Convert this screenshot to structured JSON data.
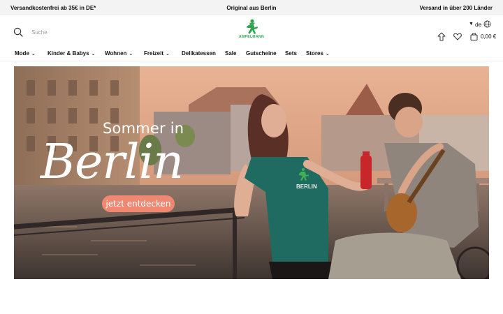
{
  "topbar": {
    "left": "Versandkostenfrei ab 35€ in DE*",
    "center": "Original aus Berlin",
    "right": "Versand in über 200 Länder"
  },
  "header": {
    "search_placeholder": "Suche",
    "logo_text": "AMPELMANN",
    "language": "de",
    "cart_total": "0,00 €",
    "brand_color": "#2ea44f",
    "icons": [
      "search-icon",
      "globe-icon",
      "upload-icon",
      "heart-icon",
      "bag-icon",
      "chevron-down-icon"
    ]
  },
  "nav": {
    "items": [
      {
        "label": "Mode",
        "dropdown": true
      },
      {
        "label": "Kinder & Babys",
        "dropdown": true
      },
      {
        "label": "Wohnen",
        "dropdown": true
      },
      {
        "label": "Freizeit",
        "dropdown": true
      },
      {
        "label": "Delikatessen",
        "dropdown": false
      },
      {
        "label": "Sale",
        "dropdown": false
      },
      {
        "label": "Gutscheine",
        "dropdown": false
      },
      {
        "label": "Sets",
        "dropdown": false
      },
      {
        "label": "Stores",
        "dropdown": true
      }
    ]
  },
  "hero": {
    "overline": "Sommer in",
    "title": "Berlin",
    "cta_label": "jetzt entdecken",
    "shirt_print": "BERLIN",
    "cta_color": "#f08770"
  }
}
